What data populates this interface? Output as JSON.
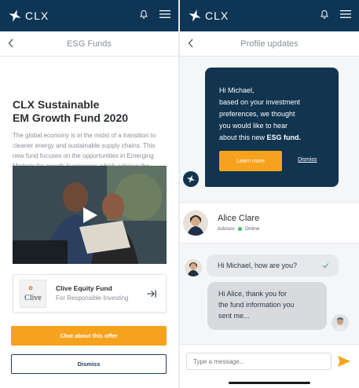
{
  "left_screen": {
    "header": {
      "logo_text": "CLX"
    },
    "subheader": {
      "title": "ESG Funds"
    },
    "fund": {
      "title_line1": "CLX Sustainable",
      "title_line2": "EM Growth Fund 2020",
      "description": "The global economy is in the midst of a transition to cleaner energy and sustainable supply chains. This new fund focuses on the opportunities in Emerging Markets for growth businesses which achieve the highest sustainability ratings in their sectors."
    },
    "fund_card": {
      "logo_text": "Clive",
      "name": "Clive Equity Fund",
      "subtitle": "For Responsible Investing"
    },
    "buttons": {
      "chat": "Chat about this offer",
      "dismiss": "Dismiss"
    }
  },
  "right_screen": {
    "header": {
      "logo_text": "CLX"
    },
    "subheader": {
      "title": "Profile updates"
    },
    "offer": {
      "line1": "Hi Michael,",
      "line2": "based on your investment",
      "line3": "preferences, we thought",
      "line4": "you would like to hear",
      "line5_prefix": "about this new ",
      "line5_bold": "ESG fund.",
      "learn_more": "Learn more",
      "dismiss": "Dismiss"
    },
    "advisor": {
      "name": "Alice Clare",
      "role": "Advisor",
      "status": "Online"
    },
    "messages": [
      {
        "text": "Hi Michael, how are you?"
      },
      {
        "line1": "Hi Alice, thank you for",
        "line2": "the fund information you",
        "line3": "sent me..."
      }
    ],
    "composer": {
      "placeholder": "Type a message..."
    }
  },
  "colors": {
    "navy": "#0f3555",
    "orange": "#f7a21c",
    "online": "#3cbf6e"
  }
}
